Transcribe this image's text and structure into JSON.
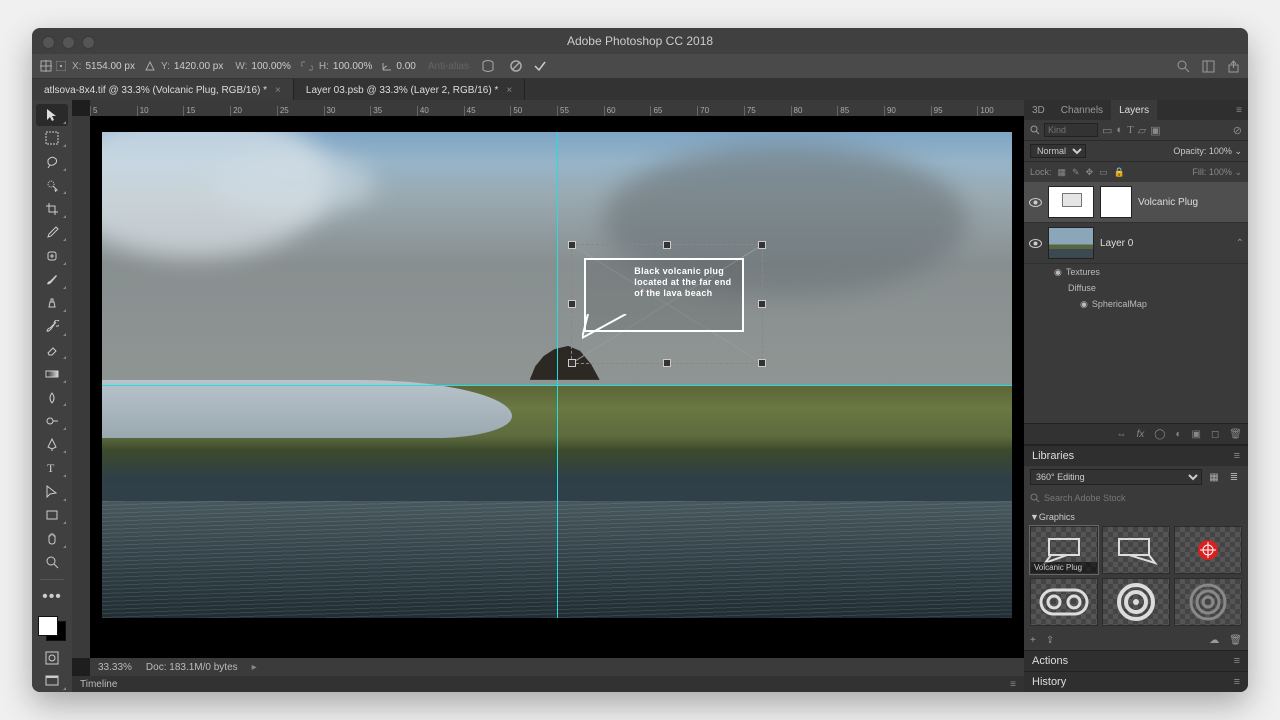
{
  "app_title": "Adobe Photoshop CC 2018",
  "options": {
    "x": "5154.00 px",
    "y": "1420.00 px",
    "w": "100.00%",
    "h": "100.00%",
    "angle": "0.00",
    "antialias": "Anti-alias"
  },
  "tabs": [
    {
      "label": "atlsova-8x4.tif @ 33.3% (Volcanic Plug, RGB/16) *",
      "active": true
    },
    {
      "label": "Layer 03.psb @ 33.3% (Layer 2, RGB/16) *",
      "active": false
    }
  ],
  "ruler_marks": [
    "5",
    "10",
    "15",
    "20",
    "25",
    "30",
    "35",
    "40",
    "45",
    "50",
    "55",
    "60",
    "65",
    "70",
    "75",
    "80",
    "85",
    "90",
    "95",
    "100"
  ],
  "callout_text": "Black volcanic plug located at the far end of the lava beach",
  "status": {
    "zoom": "33.33%",
    "doc": "Doc: 183.1M/0 bytes"
  },
  "timeline_label": "Timeline",
  "panel_tabs": {
    "a": [
      "3D",
      "Channels",
      "Layers"
    ],
    "active": "Layers"
  },
  "filter": {
    "placeholder": "Kind"
  },
  "blend": {
    "mode": "Normal",
    "opacity_label": "Opacity:",
    "opacity": "100%"
  },
  "lock": {
    "label": "Lock:",
    "fill_label": "Fill:",
    "fill": "100%"
  },
  "layers": [
    {
      "name": "Volcanic Plug",
      "selected": true,
      "hasMask": true,
      "type": "shape"
    },
    {
      "name": "Layer 0",
      "selected": false,
      "hasMask": false,
      "type": "photo"
    }
  ],
  "layer_sub": [
    "Textures",
    "Diffuse",
    "SphericalMap"
  ],
  "libraries": {
    "title": "Libraries",
    "set": "360° Editing",
    "search": "Search Adobe Stock",
    "group": "Graphics",
    "item_caption": "Volcanic Plug"
  },
  "extra_panels": [
    "Actions",
    "History"
  ]
}
